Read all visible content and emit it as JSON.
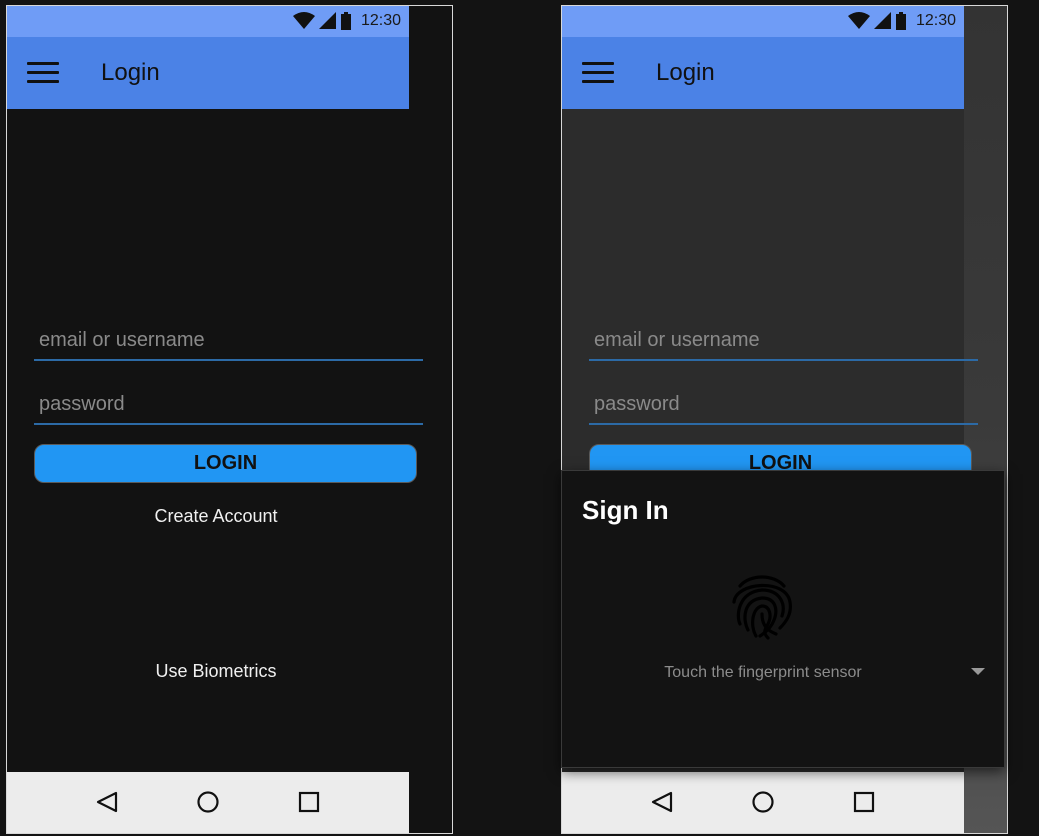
{
  "status_bar": {
    "time": "12:30"
  },
  "app_bar": {
    "title": "Login"
  },
  "form": {
    "email_placeholder": "email or username",
    "email_value": "",
    "password_placeholder": "password",
    "password_value": "",
    "login_label": "LOGIN",
    "create_account_label": "Create Account",
    "biometrics_label": "Use Biometrics"
  },
  "dialog": {
    "title": "Sign In",
    "hint": "Touch the fingerprint sensor",
    "icon": "fingerprint-icon"
  },
  "navigation": {
    "back_icon": "back-triangle-icon",
    "home_icon": "home-circle-icon",
    "recents_icon": "recents-square-icon"
  },
  "colors": {
    "status_bar": "#6f9cf6",
    "app_bar": "#4b82e6",
    "accent_button": "#2196f3",
    "field_underline": "#2c6aa6",
    "background": "#121212"
  }
}
